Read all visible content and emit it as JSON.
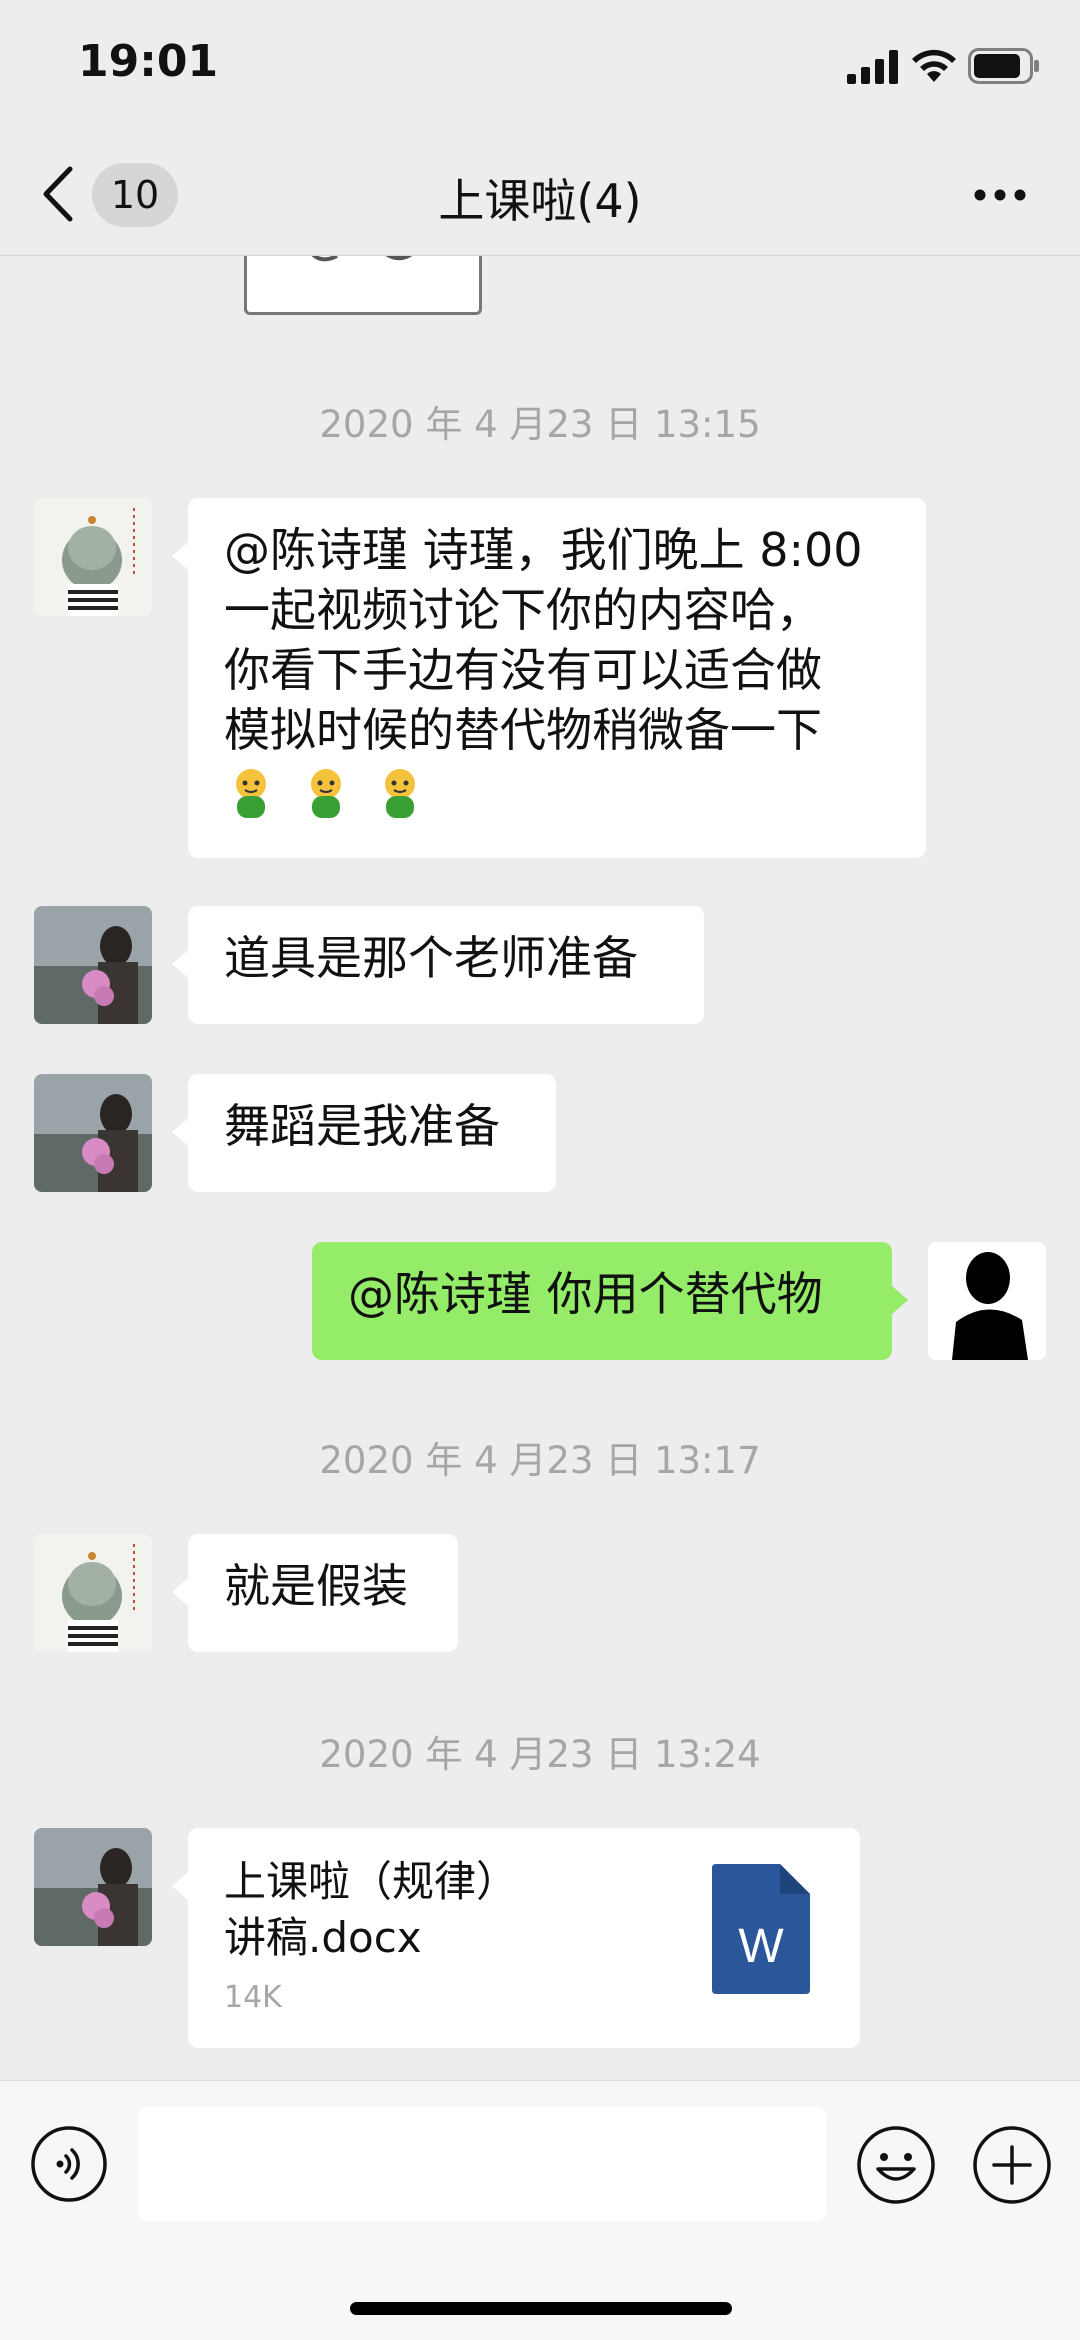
{
  "status_bar": {
    "time": "19:01"
  },
  "nav": {
    "unread_count": "10",
    "title": "上课啦(4)"
  },
  "messages": {
    "ts1": "2020 年 4 月23 日 13:15",
    "m1": {
      "line1": "@陈诗瑾 诗瑾，我们晚上 8:00",
      "line2": "一起视频讨论下你的内容哈，",
      "line3": "你看下手边有没有可以适合做",
      "line4": "模拟时候的替代物稍微备一下"
    },
    "m2": "道具是那个老师准备",
    "m3": "舞蹈是我准备",
    "m4": "@陈诗瑾 你用个替代物",
    "ts2": "2020 年 4 月23 日 13:17",
    "m5": "就是假装",
    "ts3": "2020 年 4 月23 日 13:24",
    "file": {
      "name_line1": "上课啦（规律）",
      "name_line2": "讲稿.docx",
      "size": "14K",
      "icon_letter": "W"
    }
  },
  "icons": [
    "back-icon",
    "more-icon",
    "voice-icon",
    "emoji-icon",
    "plus-icon",
    "word-file-icon"
  ],
  "colors": {
    "bg": "#ededed",
    "my_bubble": "#95ec69",
    "word_blue": "#2b579a"
  }
}
